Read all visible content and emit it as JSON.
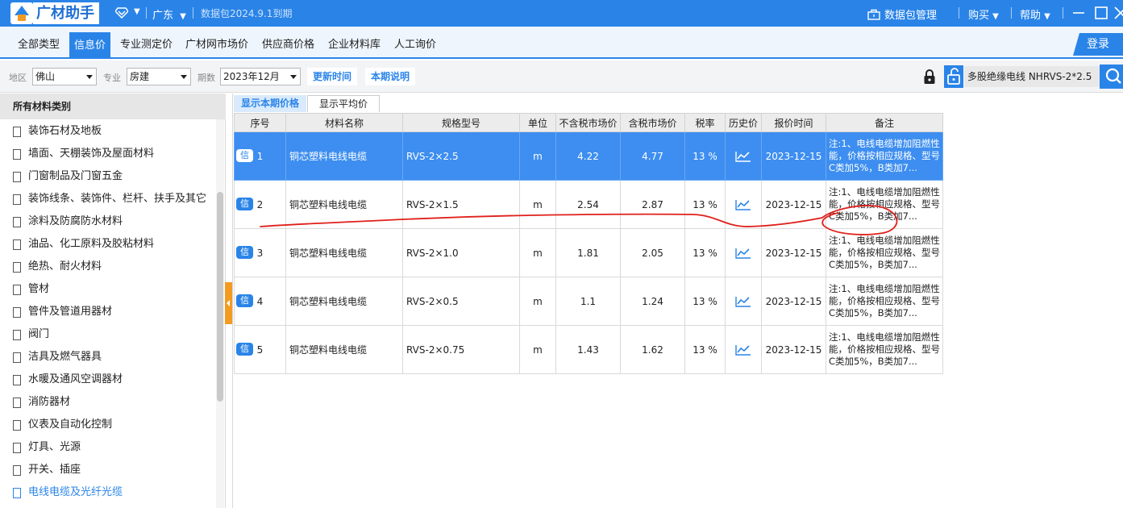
{
  "titlebar": {
    "app_name": "广材助手",
    "region": "广东",
    "expiry": "数据包2024.9.1到期",
    "package_mgmt": "数据包管理",
    "buy": "购买",
    "help": "帮助"
  },
  "nav": {
    "tabs": [
      "全部类型",
      "信息价",
      "专业测定价",
      "广材网市场价",
      "供应商价格",
      "企业材料库",
      "人工询价"
    ],
    "active_index": 1,
    "login": "登录"
  },
  "filters": {
    "area_label": "地区",
    "area_value": "佛山",
    "profession_label": "专业",
    "profession_value": "房建",
    "period_label": "期数",
    "period_value": "2023年12月",
    "update_time": "更新时间",
    "period_note": "本期说明",
    "search_value": "多股绝缘电线 NHRVS-2*2.5"
  },
  "sidebar": {
    "header": "所有材料类别",
    "items": [
      "装饰石材及地板",
      "墙面、天棚装饰及屋面材料",
      "门窗制品及门窗五金",
      "装饰线条、装饰件、栏杆、扶手及其它",
      "涂料及防腐防水材料",
      "油品、化工原料及胶粘材料",
      "绝热、耐火材料",
      "管材",
      "管件及管道用器材",
      "阀门",
      "洁具及燃气器具",
      "水暖及通风空调器材",
      "消防器材",
      "仪表及自动化控制",
      "灯具、光源",
      "开关、插座",
      "电线电缆及光纤光缆"
    ],
    "active_index": 16
  },
  "subtabs": {
    "current": "显示本期价格",
    "average": "显示平均价"
  },
  "table": {
    "headers": [
      "序号",
      "材料名称",
      "规格型号",
      "单位",
      "不含税市场价",
      "含税市场价",
      "税率",
      "历史价",
      "报价时间",
      "备注"
    ],
    "badge": "信",
    "rows": [
      {
        "seq": "1",
        "name": "铜芯塑料电线电缆",
        "spec": "RVS-2×2.5",
        "unit": "m",
        "price_ex": "4.22",
        "price_inc": "4.77",
        "tax": "13 %",
        "date": "2023-12-15",
        "remark": "注:1、电线电缆增加阻燃性能，价格按相应规格、型号C类加5%，B类加7..."
      },
      {
        "seq": "2",
        "name": "铜芯塑料电线电缆",
        "spec": "RVS-2×1.5",
        "unit": "m",
        "price_ex": "2.54",
        "price_inc": "2.87",
        "tax": "13 %",
        "date": "2023-12-15",
        "remark": "注:1、电线电缆增加阻燃性能，价格按相应规格、型号C类加5%，B类加7..."
      },
      {
        "seq": "3",
        "name": "铜芯塑料电线电缆",
        "spec": "RVS-2×1.0",
        "unit": "m",
        "price_ex": "1.81",
        "price_inc": "2.05",
        "tax": "13 %",
        "date": "2023-12-15",
        "remark": "注:1、电线电缆增加阻燃性能，价格按相应规格、型号C类加5%，B类加7..."
      },
      {
        "seq": "4",
        "name": "铜芯塑料电线电缆",
        "spec": "RVS-2×0.5",
        "unit": "m",
        "price_ex": "1.1",
        "price_inc": "1.24",
        "tax": "13 %",
        "date": "2023-12-15",
        "remark": "注:1、电线电缆增加阻燃性能，价格按相应规格、型号C类加5%，B类加7..."
      },
      {
        "seq": "5",
        "name": "铜芯塑料电线电缆",
        "spec": "RVS-2×0.75",
        "unit": "m",
        "price_ex": "1.43",
        "price_inc": "1.62",
        "tax": "13 %",
        "date": "2023-12-15",
        "remark": "注:1、电线电缆增加阻燃性能，价格按相应规格、型号C类加5%，B类加7..."
      }
    ],
    "selected_index": 0
  },
  "colors": {
    "brand": "#2a84e8",
    "selected_row": "#3d8ef0",
    "accent_orange": "#f39a21",
    "annotation_red": "#e0201b"
  },
  "icons": {
    "vip": "diamond-icon",
    "package": "briefcase-icon",
    "lock": "lock-icon",
    "unlock": "unlock-icon",
    "search": "search-icon",
    "history": "trend-chart-icon",
    "category": "document-icon"
  }
}
